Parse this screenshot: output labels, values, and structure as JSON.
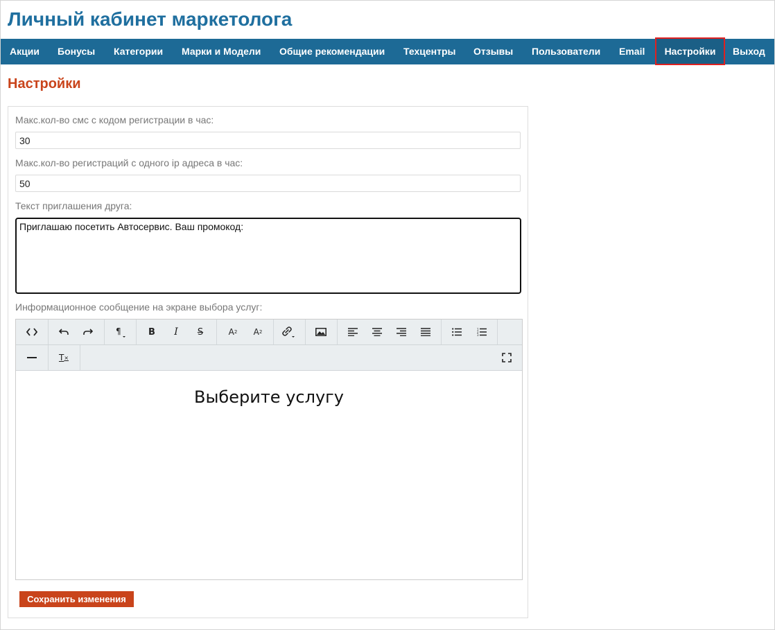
{
  "header": {
    "title": "Личный кабинет маркетолога"
  },
  "nav": {
    "items": [
      {
        "label": "Акции"
      },
      {
        "label": "Бонусы"
      },
      {
        "label": "Категории"
      },
      {
        "label": "Марки и Модели"
      },
      {
        "label": "Общие рекомендации"
      },
      {
        "label": "Техцентры"
      },
      {
        "label": "Отзывы"
      },
      {
        "label": "Пользователи"
      },
      {
        "label": "Email"
      },
      {
        "label": "Настройки"
      },
      {
        "label": "Выход"
      }
    ],
    "active": "Настройки",
    "highlight_color": "#e02020",
    "bar_color": "#1d6a96"
  },
  "page": {
    "heading": "Настройки"
  },
  "form": {
    "sms_label": "Макс.кол-во смс с кодом регистрации в час:",
    "sms_value": "30",
    "ip_label": "Макс.кол-во регистраций с одного ip адреса в час:",
    "ip_value": "50",
    "invite_label": "Текст приглашения друга:",
    "invite_value": "Приглашаю посетить Автосервис. Ваш промокод:",
    "info_label": "Информационное сообщение на экране выбора услуг:",
    "editor_content_heading": "Выберите услугу",
    "save_label": "Сохранить изменения"
  },
  "toolbar": {
    "buttons": [
      {
        "name": "code-view-icon",
        "glyph": "<>"
      },
      {
        "name": "undo-icon",
        "glyph": "↶"
      },
      {
        "name": "redo-icon",
        "glyph": "↷"
      },
      {
        "name": "paragraph-format-icon",
        "glyph": "¶"
      },
      {
        "name": "bold-icon",
        "glyph": "B"
      },
      {
        "name": "italic-icon",
        "glyph": "I"
      },
      {
        "name": "strikethrough-icon",
        "glyph": "S"
      },
      {
        "name": "superscript-icon",
        "glyph": "A²"
      },
      {
        "name": "subscript-icon",
        "glyph": "A₂"
      },
      {
        "name": "link-icon",
        "glyph": "🔗"
      },
      {
        "name": "image-icon",
        "glyph": "▣"
      },
      {
        "name": "align-left-icon",
        "glyph": "≡"
      },
      {
        "name": "align-center-icon",
        "glyph": "≡"
      },
      {
        "name": "align-right-icon",
        "glyph": "≡"
      },
      {
        "name": "align-justify-icon",
        "glyph": "≡"
      },
      {
        "name": "unordered-list-icon",
        "glyph": "☰"
      },
      {
        "name": "ordered-list-icon",
        "glyph": "☷"
      },
      {
        "name": "horizontal-line-icon",
        "glyph": "—"
      },
      {
        "name": "clear-formatting-icon",
        "glyph": "Tₓ"
      },
      {
        "name": "fullscreen-icon",
        "glyph": "⛶"
      }
    ]
  },
  "colors": {
    "title": "#1f6f9f",
    "accent": "#c9441b",
    "label": "#777777"
  }
}
